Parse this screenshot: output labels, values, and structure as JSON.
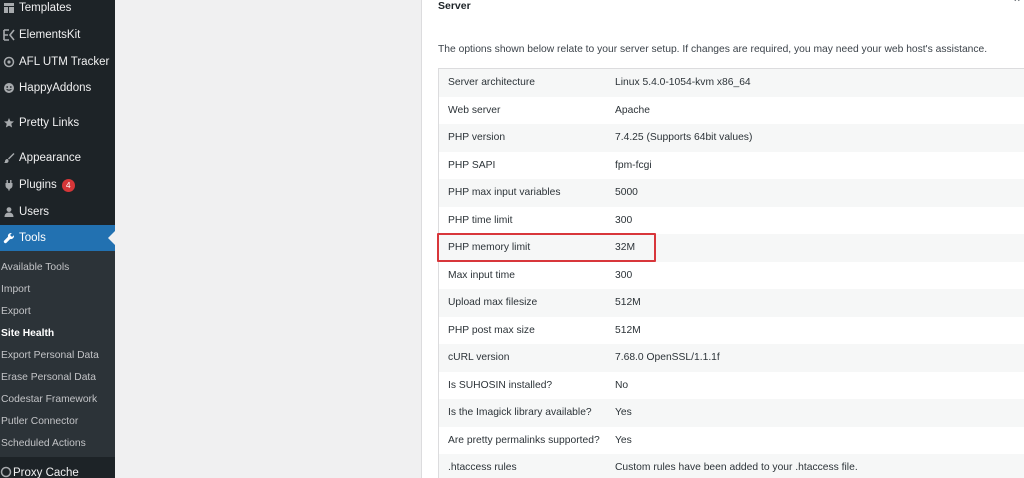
{
  "sidebar": {
    "items": [
      {
        "label": "Templates",
        "icon": "templates-icon"
      },
      {
        "label": "ElementsKit",
        "icon": "elementskit-icon"
      },
      {
        "label": "AFL UTM Tracker",
        "icon": "tracker-icon"
      },
      {
        "label": "HappyAddons",
        "icon": "happyaddons-icon"
      },
      {
        "label": "Pretty Links",
        "icon": "star-icon"
      },
      {
        "label": "Appearance",
        "icon": "brush-icon"
      },
      {
        "label": "Plugins",
        "icon": "plugin-icon",
        "badge": "4"
      },
      {
        "label": "Users",
        "icon": "user-icon"
      },
      {
        "label": "Tools",
        "icon": "wrench-icon"
      }
    ],
    "submenu": [
      "Available Tools",
      "Import",
      "Export",
      "Site Health",
      "Export Personal Data",
      "Erase Personal Data",
      "Codestar Framework",
      "Putler Connector",
      "Scheduled Actions"
    ],
    "bottom": {
      "label": "Proxy Cache",
      "icon": "cache-icon"
    }
  },
  "panel": {
    "title": "Server",
    "description": "The options shown below relate to your server setup. If changes are required, you may need your web host's assistance.",
    "rows": [
      {
        "label": "Server architecture",
        "value": "Linux 5.4.0-1054-kvm x86_64"
      },
      {
        "label": "Web server",
        "value": "Apache"
      },
      {
        "label": "PHP version",
        "value": "7.4.25 (Supports 64bit values)"
      },
      {
        "label": "PHP SAPI",
        "value": "fpm-fcgi"
      },
      {
        "label": "PHP max input variables",
        "value": "5000"
      },
      {
        "label": "PHP time limit",
        "value": "300"
      },
      {
        "label": "PHP memory limit",
        "value": "32M"
      },
      {
        "label": "Max input time",
        "value": "300"
      },
      {
        "label": "Upload max filesize",
        "value": "512M"
      },
      {
        "label": "PHP post max size",
        "value": "512M"
      },
      {
        "label": "cURL version",
        "value": "7.68.0 OpenSSL/1.1.1f"
      },
      {
        "label": "Is SUHOSIN installed?",
        "value": "No"
      },
      {
        "label": "Is the Imagick library available?",
        "value": "Yes"
      },
      {
        "label": "Are pretty permalinks supported?",
        "value": "Yes"
      },
      {
        "label": ".htaccess rules",
        "value": "Custom rules have been added to your .htaccess file."
      }
    ]
  },
  "colors": {
    "sidebar_bg": "#1d2327",
    "submenu_bg": "#2c3338",
    "active_bg": "#2271b1",
    "badge_bg": "#d63638",
    "highlight_border": "#d8363b"
  }
}
